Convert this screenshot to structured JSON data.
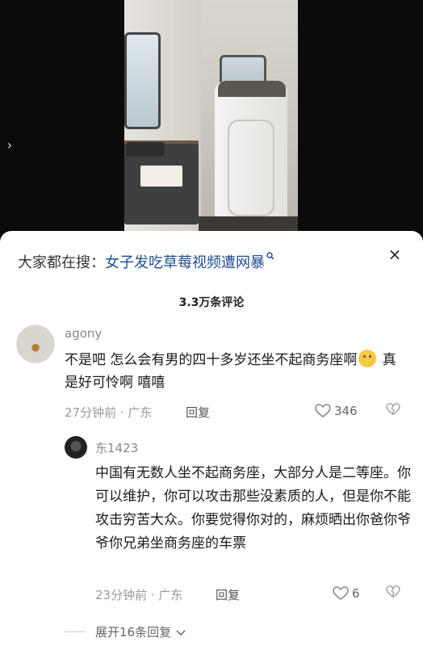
{
  "video": {
    "nav_arrow": "›"
  },
  "sheet": {
    "search_prefix": "大家都在搜：",
    "search_link": "女子发吃草莓视频遭网暴",
    "search_icon": "search-icon",
    "close_glyph": "×",
    "comment_count": "3.3万条评论"
  },
  "comments": [
    {
      "user": "agony",
      "text_part1": "不是吧 怎么会有男的四十多岁还坐不起商务座啊",
      "text_part2": " 真是好可怜啊 嘻嘻",
      "time_location": "27分钟前 · 广东",
      "reply_label": "回复",
      "likes": "346"
    }
  ],
  "reply": {
    "user": "东1423",
    "text": "中国有无数人坐不起商务座，大部分人是二等座。你可以维护，你可以攻击那些没素质的人，但是你不能攻击穷苦大众。你要觉得你对的，麻烦晒出你爸你爷爷你兄弟坐商务座的车票",
    "time_location": "23分钟前 · 广东",
    "reply_label": "回复",
    "likes": "6"
  },
  "expand_label": "展开16条回复",
  "colors": {
    "link": "#1f4e8c",
    "muted": "#999999"
  }
}
